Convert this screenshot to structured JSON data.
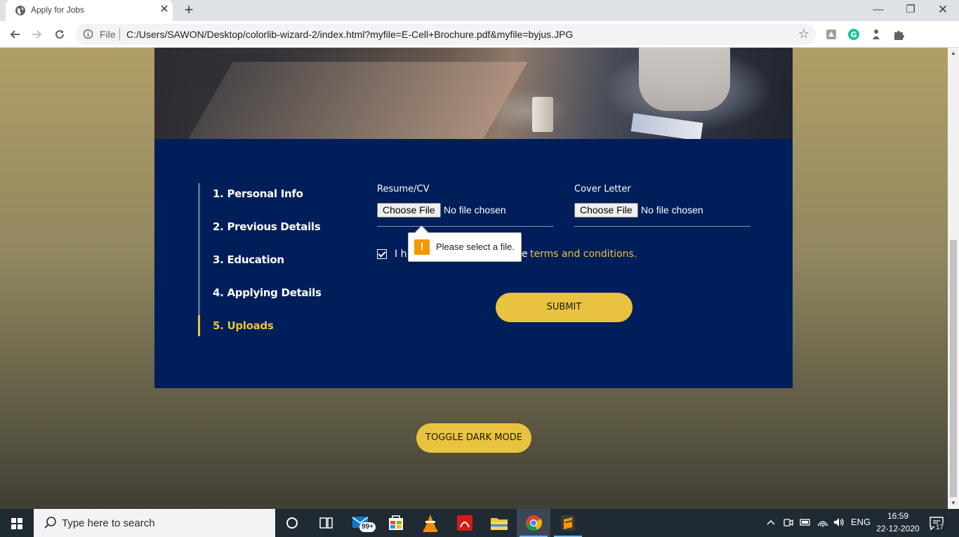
{
  "browser": {
    "tab_title": "Apply for Jobs",
    "address_scheme": "File",
    "address_url": "C:/Users/SAWON/Desktop/colorlib-wizard-2/index.html?myfile=E-Cell+Brochure.pdf&myfile=byjus.JPG"
  },
  "wizard": {
    "steps": [
      {
        "label": "1. Personal Info",
        "active": false
      },
      {
        "label": "2. Previous Details",
        "active": false
      },
      {
        "label": "3. Education",
        "active": false
      },
      {
        "label": "4. Applying Details",
        "active": false
      },
      {
        "label": "5. Uploads",
        "active": true
      }
    ],
    "resume": {
      "label": "Resume/CV",
      "button": "Choose File",
      "status": "No file chosen"
    },
    "cover_letter": {
      "label": "Cover Letter",
      "button": "Choose File",
      "status": "No file chosen"
    },
    "agree": {
      "checked": true,
      "text_visible": "I h",
      "text_tail": "e",
      "link": "terms and conditions."
    },
    "validation_tooltip": "Please select a file.",
    "submit_label": "SUBMIT"
  },
  "toggle_dark_label": "TOGGLE DARK MODE",
  "taskbar": {
    "search_placeholder": "Type here to search",
    "mail_badge": "99+",
    "tray_lang": "ENG",
    "time": "16:59",
    "date": "22-12-2020",
    "notification_count": "17"
  },
  "colors": {
    "card_bg": "#001e59",
    "accent": "#e9c33f",
    "text": "#ffffff"
  }
}
